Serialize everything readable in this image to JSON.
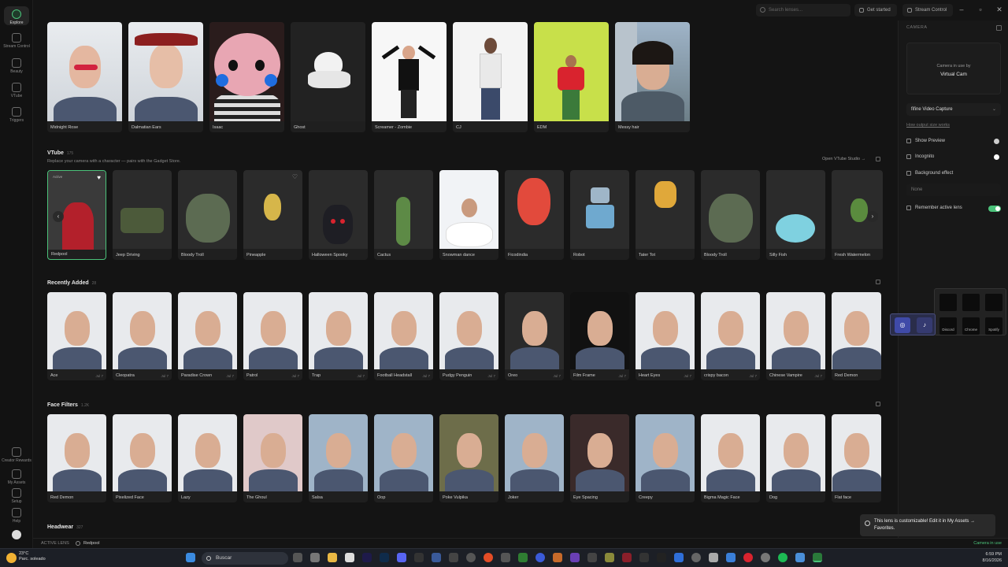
{
  "rail": {
    "items": [
      {
        "label": "Explore",
        "icon": "explore-icon"
      },
      {
        "label": "Stream Control",
        "icon": "stream-control-icon"
      },
      {
        "label": "Beauty",
        "icon": "beauty-icon"
      },
      {
        "label": "VTube",
        "icon": "vtube-icon"
      },
      {
        "label": "Triggers",
        "icon": "triggers-icon"
      }
    ],
    "bottom_items": [
      {
        "label": "Creator Rewards",
        "icon": "rewards-icon"
      },
      {
        "label": "My Assets",
        "icon": "assets-icon"
      },
      {
        "label": "Setup",
        "icon": "setup-icon"
      },
      {
        "label": "Help",
        "icon": "help-icon"
      }
    ]
  },
  "topbar": {
    "search_placeholder": "Search lenses...",
    "get_started": "Get started",
    "stream_control": "Stream Control"
  },
  "top_row": [
    {
      "label": "Midnight Rose"
    },
    {
      "label": "Dalmatian Ears"
    },
    {
      "label": "Isaac"
    },
    {
      "label": "Ghost"
    },
    {
      "label": "Screamer - Zombie"
    },
    {
      "label": "CJ"
    },
    {
      "label": "EDM"
    },
    {
      "label": "Messy hair"
    }
  ],
  "vtube": {
    "title": "VTube",
    "count": "175",
    "subtitle": "Replace your camera with a character — pairs with the Gadget Store.",
    "open_link": "Open VTube Studio →",
    "active_badge": "Active",
    "items": [
      {
        "label": "Redpool"
      },
      {
        "label": "Jeep Driving"
      },
      {
        "label": "Bloody Troll"
      },
      {
        "label": "Pineapple"
      },
      {
        "label": "Halloween Spooky"
      },
      {
        "label": "Cactus"
      },
      {
        "label": "Snowman dance"
      },
      {
        "label": "Ficodindia"
      },
      {
        "label": "Robot"
      },
      {
        "label": "Tater Tot"
      },
      {
        "label": "Bloody Troll"
      },
      {
        "label": "Silly Fish"
      },
      {
        "label": "Fresh Watermelon"
      }
    ]
  },
  "recent": {
    "title": "Recently Added",
    "count": "28",
    "items": [
      {
        "label": "Ace",
        "date": "Jul 7"
      },
      {
        "label": "Cleopatra",
        "date": "Jul 7"
      },
      {
        "label": "Paradise Crown",
        "date": "Jul 7"
      },
      {
        "label": "Patrol",
        "date": "Jul 7"
      },
      {
        "label": "Trap",
        "date": "Jul 7"
      },
      {
        "label": "Football Headstall",
        "date": "Jul 7"
      },
      {
        "label": "Pudgy Penguin",
        "date": "Jul 7"
      },
      {
        "label": "Oreo",
        "date": "Jul 7"
      },
      {
        "label": "Film Frame",
        "date": "Jul 7"
      },
      {
        "label": "Heart Eyes",
        "date": "Jul 7"
      },
      {
        "label": "crispy bacon",
        "date": "Jul 7"
      },
      {
        "label": "Chinese Vampire",
        "date": "Jul 7"
      },
      {
        "label": "Red Demon",
        "date": ""
      }
    ]
  },
  "face_filters": {
    "title": "Face Filters",
    "count": "1.2K",
    "items": [
      {
        "label": "Red Demon"
      },
      {
        "label": "Pixelized Face"
      },
      {
        "label": "Lazy"
      },
      {
        "label": "The Ghoul"
      },
      {
        "label": "Salsa"
      },
      {
        "label": "Oop"
      },
      {
        "label": "Poke Vulpika"
      },
      {
        "label": "Joker"
      },
      {
        "label": "Eye Spacing"
      },
      {
        "label": "Creepy"
      },
      {
        "label": "Bigma Magic Face"
      },
      {
        "label": "Dog"
      },
      {
        "label": "Flat face"
      }
    ]
  },
  "headwear": {
    "title": "Headwear",
    "count": "327"
  },
  "camera_panel": {
    "title": "CAMERA",
    "in_use_line1": "Camera in use by",
    "in_use_line2": "Virtual Cam",
    "device": "fifine Video Capture",
    "size_link": "How output size works",
    "show_preview": "Show Preview",
    "incognito": "Incognito",
    "background_effect": "Background effect",
    "background_value": "None",
    "remember_lens": "Remember active lens"
  },
  "mini_panel": {
    "tiles": [
      "Discord",
      "Chrome",
      "Spotify"
    ]
  },
  "bottombar": {
    "active_label": "ACTIVE LENS",
    "active_value": "Redpool",
    "camera_status": "Camera in use"
  },
  "toast": {
    "text": "This lens is customizable! Edit it in My Assets → Favorites."
  },
  "taskbar": {
    "weather_temp": "23°C",
    "weather_desc": "Parc. soleado",
    "search": "Buscar",
    "time": "6:59 PM",
    "date": "8/16/2026"
  },
  "colors": {
    "accent": "#4bc27a",
    "background": "#141414",
    "panel": "#181818"
  }
}
